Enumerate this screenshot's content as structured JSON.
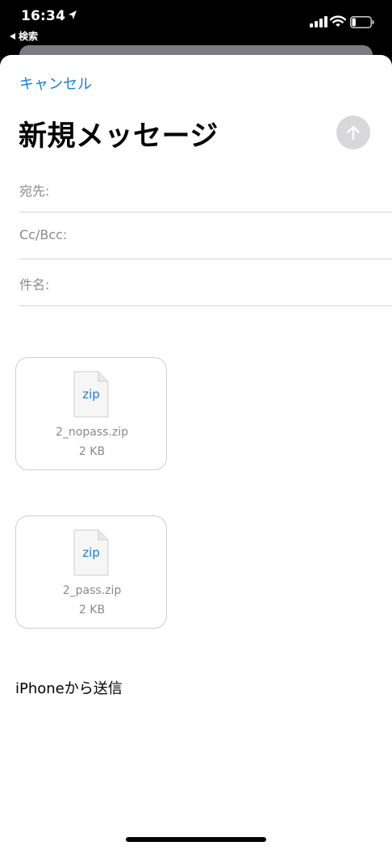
{
  "status_bar": {
    "time": "16:34",
    "back_app": "検索",
    "battery_level": 0.2,
    "location_icon": "location-arrow-icon",
    "signal_icon": "cellular-signal-icon",
    "wifi_icon": "wifi-icon",
    "battery_icon": "battery-icon"
  },
  "compose": {
    "cancel_label": "キャンセル",
    "title": "新規メッセージ",
    "send_icon": "arrow-up-icon",
    "fields": {
      "to_label": "宛先:",
      "cc_label": "Cc/Bcc:",
      "subject_label": "件名:"
    },
    "attachments": [
      {
        "icon_text": "zip",
        "name": "2_nopass.zip",
        "size": "2 KB"
      },
      {
        "icon_text": "zip",
        "name": "2_pass.zip",
        "size": "2 KB"
      }
    ],
    "signature": "iPhoneから送信"
  },
  "colors": {
    "accent": "#1a7fd6",
    "send_button_disabled": "#d8d8da",
    "secondary_text": "#8a8a8e"
  }
}
